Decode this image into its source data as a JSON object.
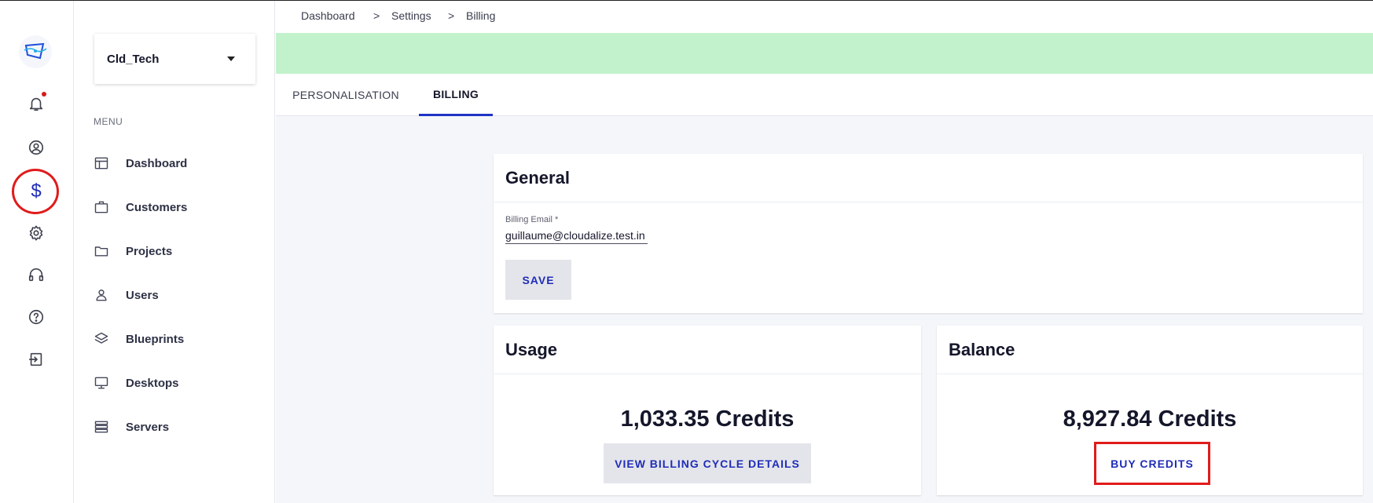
{
  "rail": {
    "icons": [
      "logo-icon",
      "bell-icon",
      "user-circle-icon",
      "dollar-icon",
      "gear-icon",
      "headset-icon",
      "help-icon",
      "logout-icon"
    ],
    "dollar_glyph": "$"
  },
  "sidebar": {
    "org_name": "Cld_Tech",
    "menu_label": "MENU",
    "items": [
      {
        "label": "Dashboard",
        "icon": "dashboard-icon"
      },
      {
        "label": "Customers",
        "icon": "briefcase-icon"
      },
      {
        "label": "Projects",
        "icon": "folder-icon"
      },
      {
        "label": "Users",
        "icon": "user-icon"
      },
      {
        "label": "Blueprints",
        "icon": "layers-icon"
      },
      {
        "label": "Desktops",
        "icon": "monitor-icon"
      },
      {
        "label": "Servers",
        "icon": "server-icon"
      }
    ]
  },
  "breadcrumb": {
    "items": [
      "Dashboard",
      "Settings",
      "Billing"
    ],
    "separator": ">"
  },
  "tabs": [
    {
      "label": "PERSONALISATION",
      "active": false
    },
    {
      "label": "BILLING",
      "active": true
    }
  ],
  "general": {
    "title": "General",
    "email_label": "Billing Email *",
    "email_value": "guillaume@cloudalize.test.in",
    "save_label": "SAVE"
  },
  "usage": {
    "title": "Usage",
    "credits": "1,033.35 Credits",
    "button_label": "VIEW BILLING CYCLE DETAILS"
  },
  "balance": {
    "title": "Balance",
    "credits": "8,927.84 Credits",
    "button_label": "BUY CREDITS"
  },
  "colors": {
    "accent": "#1f2db8",
    "banner": "#c2f2cc",
    "highlight": "#e11b1b",
    "notification": "#d71a1a"
  }
}
